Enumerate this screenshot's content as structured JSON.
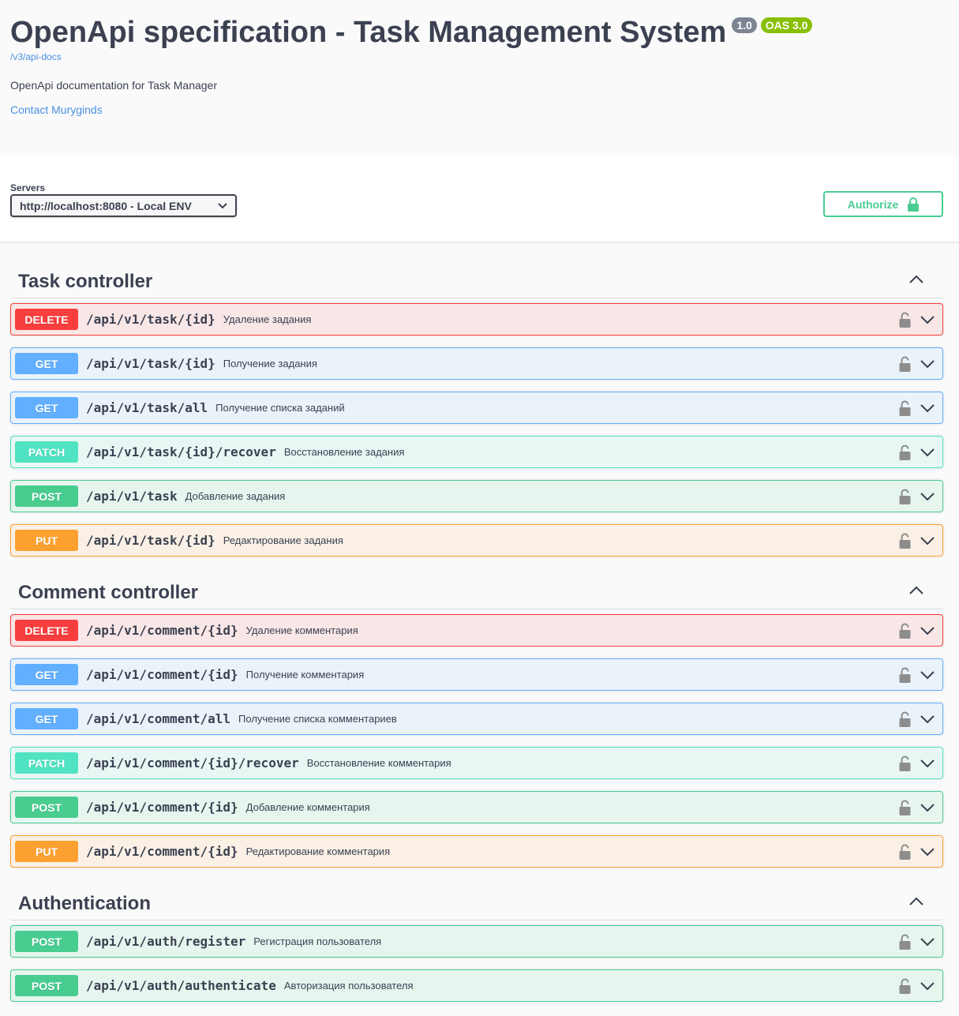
{
  "info": {
    "title": "OpenApi specification - Task Management System",
    "version_badge": "1.0",
    "oas_badge": "OAS 3.0",
    "spec_link": "/v3/api-docs",
    "description": "OpenApi documentation for Task Manager",
    "contact": "Contact Muryginds"
  },
  "scheme": {
    "servers_label": "Servers",
    "selected_server": "http://localhost:8080 - Local ENV",
    "authorize_label": "Authorize"
  },
  "colors": {
    "delete": "#f93e3e",
    "get": "#61affe",
    "patch": "#50e3c2",
    "post": "#49cc90",
    "put": "#fca130"
  },
  "tags": [
    {
      "name": "Task controller",
      "operations": [
        {
          "method": "DELETE",
          "path": "/api/v1/task/{id}",
          "summary": "Удаление задания"
        },
        {
          "method": "GET",
          "path": "/api/v1/task/{id}",
          "summary": "Получение задания"
        },
        {
          "method": "GET",
          "path": "/api/v1/task/all",
          "summary": "Получение списка заданий"
        },
        {
          "method": "PATCH",
          "path": "/api/v1/task/{id}/recover",
          "summary": "Восстановление задания"
        },
        {
          "method": "POST",
          "path": "/api/v1/task",
          "summary": "Добавление задания"
        },
        {
          "method": "PUT",
          "path": "/api/v1/task/{id}",
          "summary": "Редактирование задания"
        }
      ]
    },
    {
      "name": "Comment controller",
      "operations": [
        {
          "method": "DELETE",
          "path": "/api/v1/comment/{id}",
          "summary": "Удаление комментария"
        },
        {
          "method": "GET",
          "path": "/api/v1/comment/{id}",
          "summary": "Получение комментария"
        },
        {
          "method": "GET",
          "path": "/api/v1/comment/all",
          "summary": "Получение списка комментариев"
        },
        {
          "method": "PATCH",
          "path": "/api/v1/comment/{id}/recover",
          "summary": "Восстановление комментария"
        },
        {
          "method": "POST",
          "path": "/api/v1/comment/{id}",
          "summary": "Добавление комментария"
        },
        {
          "method": "PUT",
          "path": "/api/v1/comment/{id}",
          "summary": "Редактирование комментария"
        }
      ]
    },
    {
      "name": "Authentication",
      "operations": [
        {
          "method": "POST",
          "path": "/api/v1/auth/register",
          "summary": "Регистрация пользователя"
        },
        {
          "method": "POST",
          "path": "/api/v1/auth/authenticate",
          "summary": "Авторизация пользователя"
        }
      ]
    }
  ]
}
